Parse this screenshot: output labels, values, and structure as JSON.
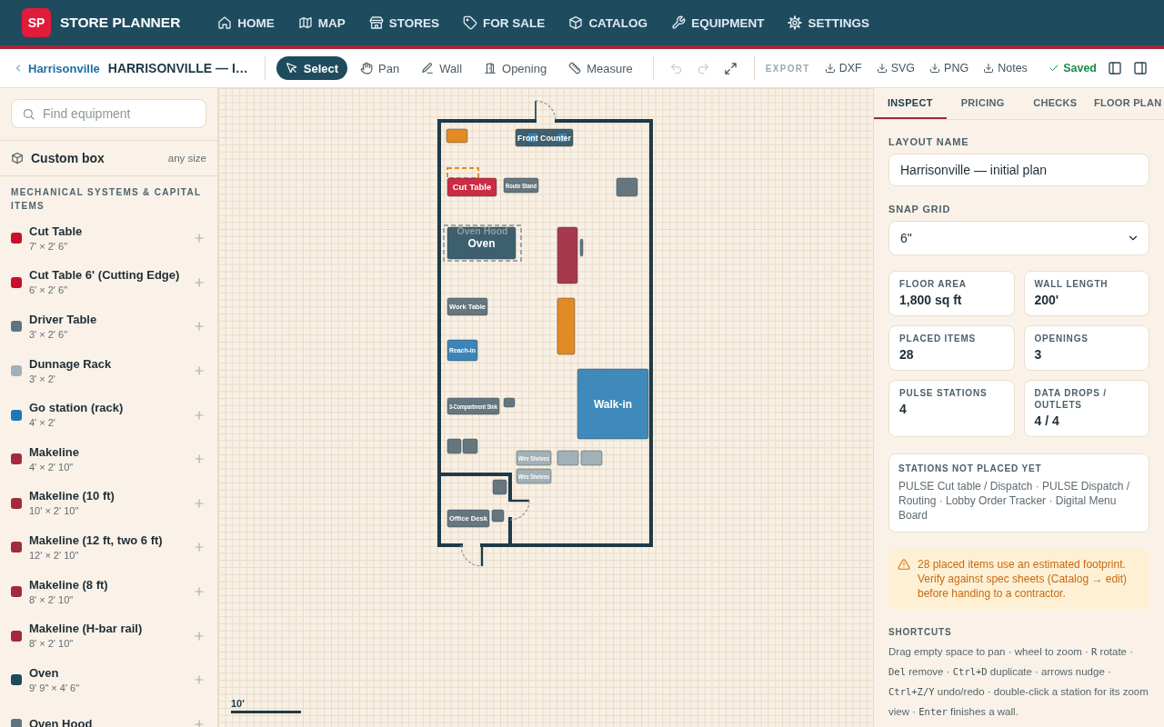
{
  "nav": {
    "logo": "SP",
    "title": "STORE PLANNER",
    "links": [
      {
        "label": "HOME"
      },
      {
        "label": "MAP"
      },
      {
        "label": "STORES"
      },
      {
        "label": "FOR SALE"
      },
      {
        "label": "CATALOG"
      },
      {
        "label": "EQUIPMENT"
      },
      {
        "label": "SETTINGS"
      }
    ]
  },
  "toolbar": {
    "back_link": "Harrisonville",
    "layout_title": "HARRISONVILLE — I…",
    "tools": [
      {
        "label": "Select",
        "selected": true
      },
      {
        "label": "Pan",
        "selected": false
      },
      {
        "label": "Wall",
        "selected": false
      },
      {
        "label": "Opening",
        "selected": false
      },
      {
        "label": "Measure",
        "selected": false
      }
    ],
    "icon_buttons": [
      {
        "disabled": true
      },
      {
        "disabled": true
      },
      {
        "disabled": false
      }
    ],
    "export_label": "EXPORT",
    "exports": [
      {
        "label": "DXF"
      },
      {
        "label": "SVG"
      },
      {
        "label": "PNG"
      },
      {
        "label": "Notes"
      }
    ],
    "save_status": "Saved"
  },
  "sidebar": {
    "search": {
      "placeholder": "Find equipment"
    },
    "custom_box": {
      "label": "Custom box",
      "hint": "any size"
    },
    "section_title": "MECHANICAL SYSTEMS & CAPITAL ITEMS",
    "items": [
      {
        "name": "Cut Table",
        "size": "7' × 2' 6\"",
        "color": "#c8102e"
      },
      {
        "name": "Cut Table 6' (Cutting Edge)",
        "size": "6' × 2' 6\"",
        "color": "#c8102e"
      },
      {
        "name": "Driver Table",
        "size": "3' × 2' 6\"",
        "color": "#5f7481"
      },
      {
        "name": "Dunnage Rack",
        "size": "3' × 2'",
        "color": "#9fb1ba"
      },
      {
        "name": "Go station (rack)",
        "size": "4' × 2'",
        "color": "#1f78b4"
      },
      {
        "name": "Makeline",
        "size": "4' × 2' 10\"",
        "color": "#a32a3e"
      },
      {
        "name": "Makeline (10 ft)",
        "size": "10' × 2' 10\"",
        "color": "#a32a3e"
      },
      {
        "name": "Makeline (12 ft, two 6 ft)",
        "size": "12' × 2' 10\"",
        "color": "#a32a3e"
      },
      {
        "name": "Makeline (8 ft)",
        "size": "8' × 2' 10\"",
        "color": "#a32a3e"
      },
      {
        "name": "Makeline (H-bar rail)",
        "size": "8' × 2' 10\"",
        "color": "#a32a3e"
      },
      {
        "name": "Oven",
        "size": "9' 9\" × 4' 6\"",
        "color": "#1f4a5e"
      },
      {
        "name": "Oven Hood",
        "color": "#5f7481"
      }
    ]
  },
  "canvas": {
    "items": [
      {
        "kind": "block",
        "color": "#e28a25"
      },
      {
        "kind": "block",
        "label": "Front Counter",
        "color": "#3e5f6d"
      },
      {
        "kind": "block",
        "color": "#3b7fa8"
      },
      {
        "kind": "block",
        "color": "#3b7fa8"
      },
      {
        "kind": "outline",
        "color": "#e28a25"
      },
      {
        "kind": "block",
        "label": "Cut Table",
        "color": "#cc2b44"
      },
      {
        "kind": "block",
        "label": "Route Stand",
        "color": "#66767f"
      },
      {
        "kind": "block",
        "color": "#66767f"
      },
      {
        "kind": "outline",
        "label": "Oven Hood",
        "color": "#9ba6ac"
      },
      {
        "kind": "block",
        "label": "Oven",
        "color": "#3e5f6d"
      },
      {
        "kind": "block",
        "color": "#a63a4c"
      },
      {
        "kind": "block",
        "color": "#5e7886"
      },
      {
        "kind": "block",
        "label": "Work Table",
        "color": "#66767f"
      },
      {
        "kind": "block",
        "color": "#e28a25"
      },
      {
        "kind": "block",
        "label": "Reach-in",
        "color": "#3d85b6"
      },
      {
        "kind": "block",
        "label": "3-Compartment Sink",
        "color": "#66767f"
      },
      {
        "kind": "block",
        "label": "Walk-in",
        "color": "#3f8aba"
      },
      {
        "kind": "block",
        "color": "#66767f"
      },
      {
        "kind": "block",
        "color": "#66767f"
      },
      {
        "kind": "block",
        "color": "#66767f"
      },
      {
        "kind": "block",
        "label": "Wire Shelves",
        "color": "#a2b0b7"
      },
      {
        "kind": "block",
        "color": "#a2b0b7"
      },
      {
        "kind": "block",
        "color": "#a2b0b7"
      },
      {
        "kind": "block",
        "label": "Wire Shelves",
        "color": "#a2b0b7"
      },
      {
        "kind": "block",
        "color": "#66767f"
      },
      {
        "kind": "block",
        "label": "Office Desk",
        "color": "#66767f"
      },
      {
        "kind": "block",
        "color": "#66767f"
      }
    ],
    "scale_label": "10'"
  },
  "inspector": {
    "tabs": [
      {
        "label": "INSPECT",
        "selected": true
      },
      {
        "label": "PRICING",
        "selected": false
      },
      {
        "label": "CHECKS",
        "selected": false
      },
      {
        "label": "FLOOR PLAN",
        "selected": false
      }
    ],
    "layout_name": {
      "label": "LAYOUT NAME",
      "value": "Harrisonville — initial plan"
    },
    "snap_grid": {
      "label": "SNAP GRID",
      "value": "6\""
    },
    "stats": [
      {
        "label": "FLOOR AREA",
        "value": "1,800 sq ft"
      },
      {
        "label": "WALL LENGTH",
        "value": "200'"
      },
      {
        "label": "PLACED ITEMS",
        "value": "28"
      },
      {
        "label": "OPENINGS",
        "value": "3"
      },
      {
        "label": "PULSE STATIONS",
        "value": "4"
      },
      {
        "label": "DATA DROPS / OUTLETS",
        "value": "4 / 4"
      }
    ],
    "unplaced": {
      "title": "STATIONS NOT PLACED YET",
      "text": "PULSE Cut table / Dispatch · PULSE Dispatch / Routing · Lobby Order Tracker · Digital Menu Board"
    },
    "warning": "28 placed items use an estimated footprint. Verify against spec sheets (Catalog → edit) before handing to a contractor.",
    "shortcuts": {
      "title": "SHORTCUTS",
      "parts": [
        {
          "kind": "text",
          "text": "Drag empty space to pan · wheel to zoom · "
        },
        {
          "kind": "key",
          "text": "R"
        },
        {
          "kind": "text",
          "text": " rotate · "
        },
        {
          "kind": "key",
          "text": "Del"
        },
        {
          "kind": "text",
          "text": " remove · "
        },
        {
          "kind": "key",
          "text": "Ctrl+D"
        },
        {
          "kind": "text",
          "text": " duplicate · arrows nudge · "
        },
        {
          "kind": "key",
          "text": "Ctrl+Z/Y"
        },
        {
          "kind": "text",
          "text": " undo/redo · double-click a station for its zoom view · "
        },
        {
          "kind": "key",
          "text": "Enter"
        },
        {
          "kind": "text",
          "text": " finishes a wall."
        }
      ]
    }
  }
}
